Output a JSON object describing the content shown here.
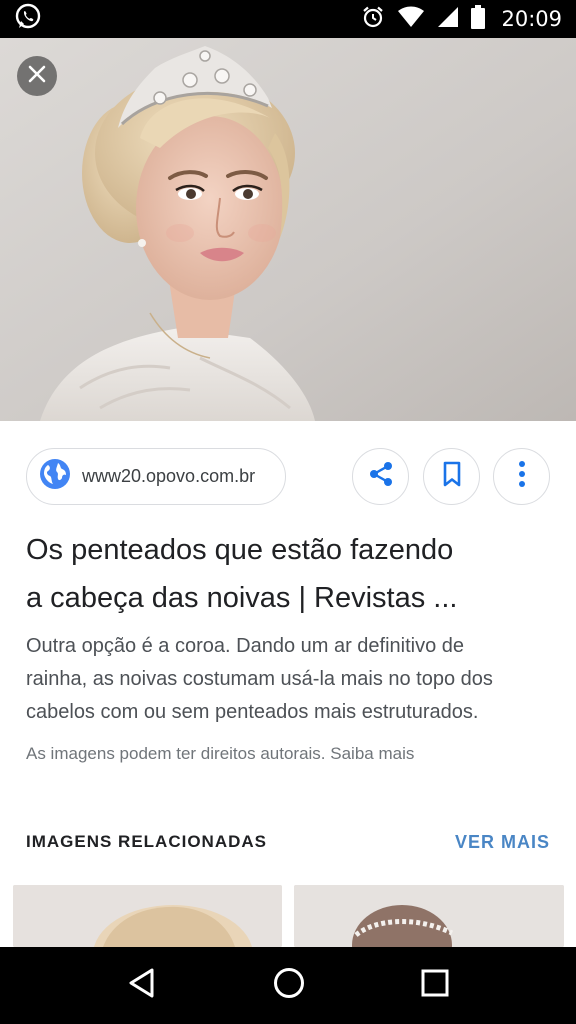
{
  "status_bar": {
    "time": "20:09",
    "icons": [
      "whatsapp-icon",
      "alarm-icon",
      "wifi-icon",
      "signal-icon",
      "battery-icon"
    ]
  },
  "hero": {
    "close_icon": "close-icon"
  },
  "source": {
    "url": "www20.opovo.com.br",
    "icon": "globe-icon"
  },
  "actions": {
    "share_icon": "share-icon",
    "bookmark_icon": "bookmark-icon",
    "more_icon": "more-vert-icon"
  },
  "result": {
    "title_line1": "Os penteados que estão fazendo",
    "title_line2": "a cabeça das noivas | Revistas ...",
    "description_line1": "Outra opção é a coroa. Dando um ar definitivo de",
    "description_line2": "rainha, as noivas costumam usá-la mais no topo dos",
    "description_line3": "cabelos com ou sem penteados mais estruturados.",
    "copyright": "As imagens podem ter direitos autorais. Saiba mais"
  },
  "related": {
    "title": "IMAGENS RELACIONADAS",
    "more_label": "VER MAIS"
  },
  "nav_bar": {
    "icons": [
      "back-icon",
      "home-icon",
      "recents-icon"
    ]
  },
  "colors": {
    "accent": "#4a86c5",
    "globe": "#4285f4",
    "text_primary": "#202124",
    "text_secondary": "#4d5156",
    "border": "#dadce0"
  }
}
